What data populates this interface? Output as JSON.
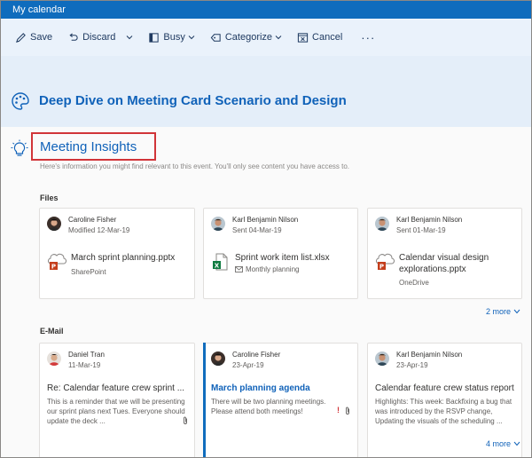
{
  "window": {
    "title": "My calendar"
  },
  "toolbar": {
    "save": "Save",
    "discard": "Discard",
    "busy": "Busy",
    "categorize": "Categorize",
    "cancel": "Cancel",
    "more": "···"
  },
  "event": {
    "title": "Deep Dive on Meeting Card Scenario and Design"
  },
  "insights": {
    "title": "Meeting Insights",
    "description": "Here's information you might find relevant to this event. You'll only see content you have access to."
  },
  "files": {
    "label": "Files",
    "more": "2 more",
    "items": [
      {
        "person": "Caroline Fisher",
        "date": "Modified 12-Mar-19",
        "file": "March sprint planning.pptx",
        "location": "SharePoint",
        "type": "pptx"
      },
      {
        "person": "Karl Benjamin Nilson",
        "date": "Sent 04-Mar-19",
        "file": "Sprint work item list.xlsx",
        "location": "Monthly planning",
        "type": "xlsx"
      },
      {
        "person": "Karl Benjamin Nilson",
        "date": "Sent 01-Mar-19",
        "file": "Calendar visual design explorations.pptx",
        "location": "OneDrive",
        "type": "pptx"
      }
    ]
  },
  "email": {
    "label": "E-Mail",
    "more": "4 more",
    "items": [
      {
        "person": "Daniel Tran",
        "date": "11-Mar-19",
        "subject": "Re: Calendar feature crew sprint ...",
        "preview": "This is a reminder that we will be presenting our sprint plans next Tues. Everyone should update the deck ..."
      },
      {
        "person": "Caroline Fisher",
        "date": "23-Apr-19",
        "subject": "March planning agenda",
        "preview": "There will be two planning meetings. Please attend both meetings!"
      },
      {
        "person": "Karl Benjamin Nilson",
        "date": "23-Apr-19",
        "subject": "Calendar feature crew status report",
        "preview": "Highlights: This week: Backfixing a bug that was introduced by the RSVP change, Updating the visuals of the scheduling ..."
      }
    ]
  },
  "colors": {
    "accent": "#0f6cbd",
    "link": "#1062b9",
    "highlight_box": "#d13438",
    "header_bg": "#e4eef9"
  }
}
